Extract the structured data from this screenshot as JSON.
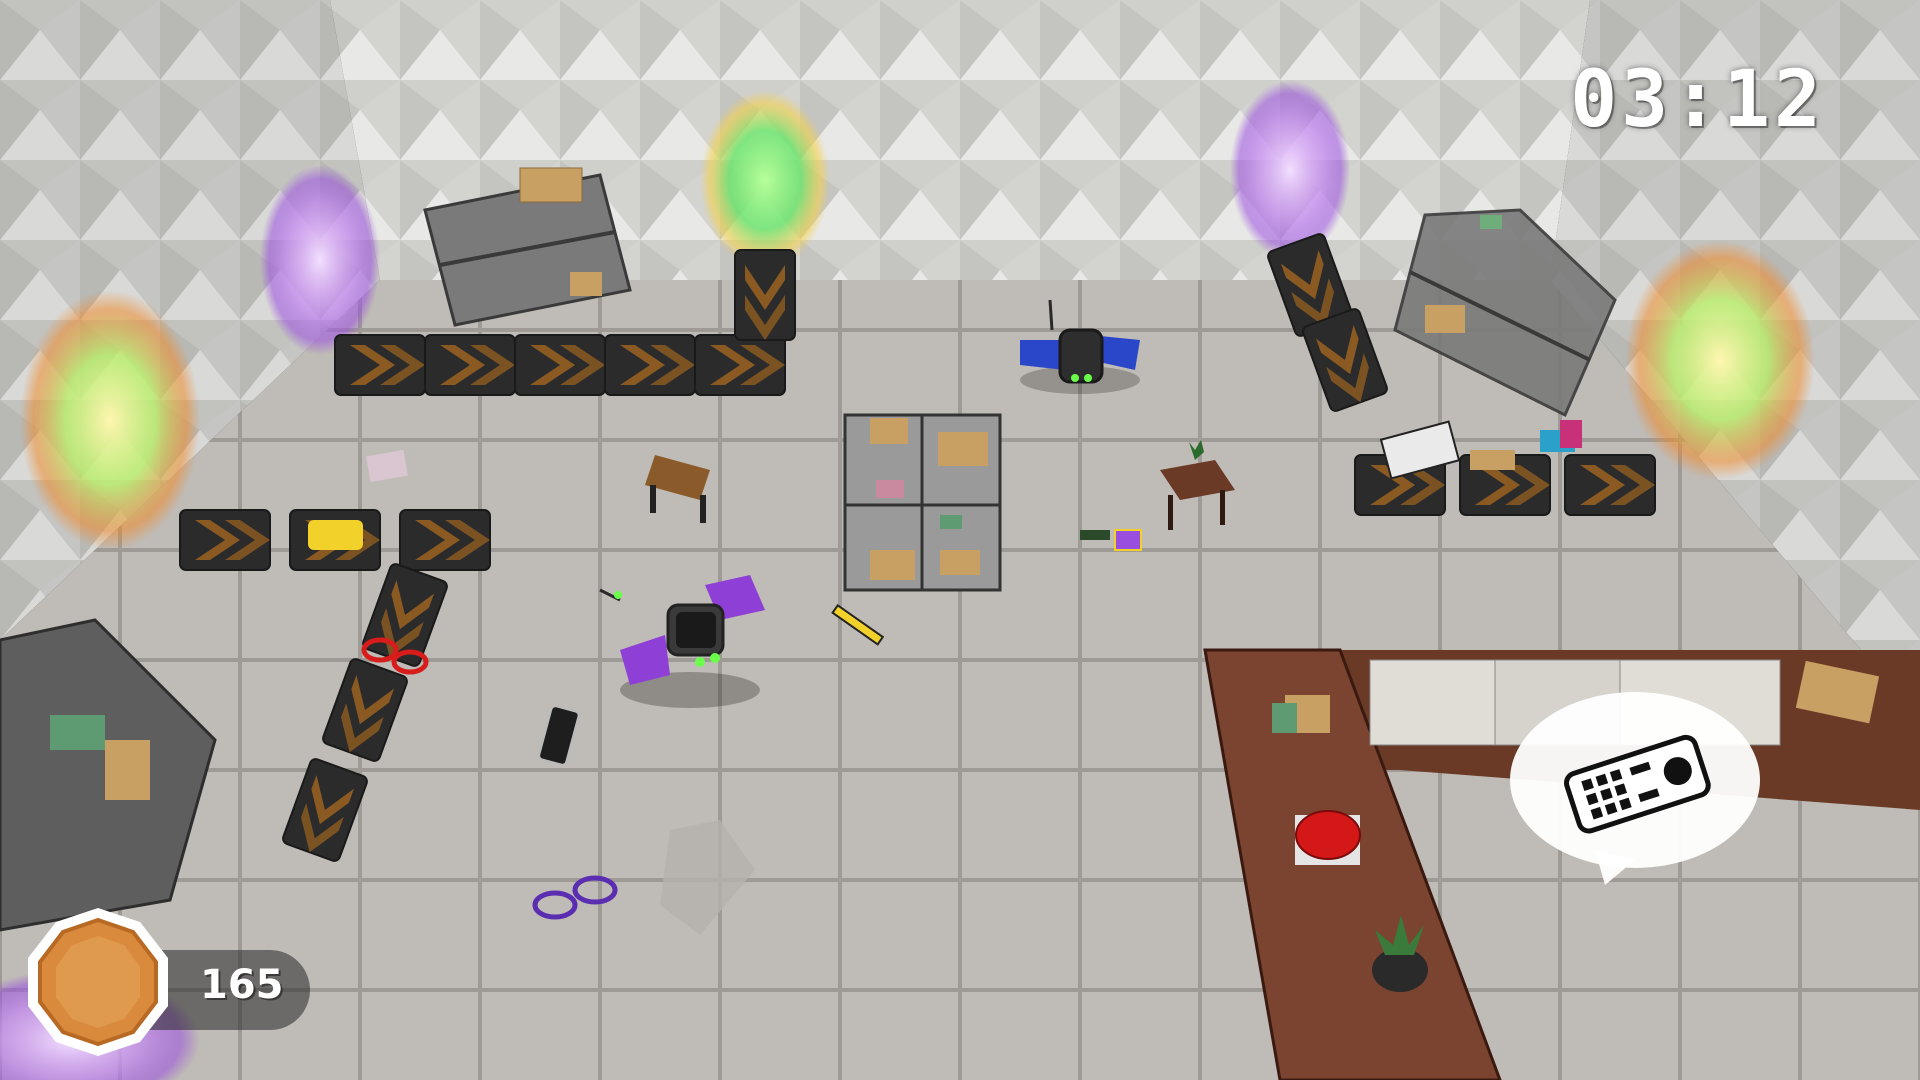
{
  "hud": {
    "timer": "03:12",
    "coins": "165"
  },
  "icons": {
    "coin": "coin-icon",
    "requested_item": "remote-control-icon"
  },
  "colors": {
    "floor": "#c9c6c1",
    "wall": "#d9d9d7",
    "conveyor": "#2b2b2b",
    "chevron": "#8a5a22",
    "coin": "#d98a3d",
    "counter": "#6b3a26",
    "button_red": "#d41818",
    "portal_green": "#7ef07a",
    "portal_purple": "#b06cf0",
    "drone_purple": "#8d3fd6",
    "drone_blue": "#2b47c9"
  }
}
